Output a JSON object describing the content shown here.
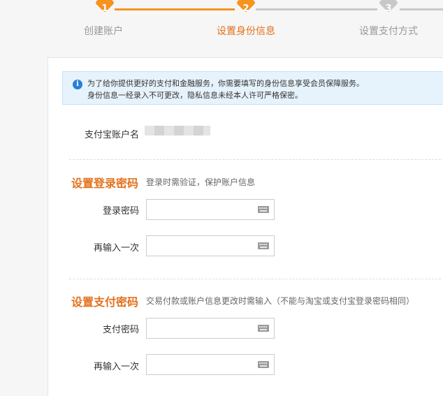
{
  "stepper": {
    "steps": [
      {
        "number": "1",
        "label": "创建账户"
      },
      {
        "number": "2",
        "label": "设置身份信息"
      },
      {
        "number": "3",
        "label": "设置支付方式"
      }
    ],
    "active_step": 2
  },
  "notice": {
    "icon": "info-icon",
    "line1": "为了给你提供更好的支付和金融服务，你需要填写的身份信息享受会员保障服务。",
    "line2": "身份信息一经录入不可更改，隐私信息未经本人许可严格保密。"
  },
  "account": {
    "label": "支付宝账户名",
    "value_masked": true
  },
  "login_password": {
    "title": "设置登录密码",
    "hint": "登录时需验证，保护账户信息",
    "fields": [
      {
        "label": "登录密码",
        "value": "",
        "icon": "keyboard-icon"
      },
      {
        "label": "再输入一次",
        "value": "",
        "icon": "keyboard-icon"
      }
    ]
  },
  "pay_password": {
    "title": "设置支付密码",
    "hint": "交易付款或账户信息更改时需输入（不能与淘宝或支付宝登录密码相同）",
    "fields": [
      {
        "label": "支付密码",
        "value": "",
        "icon": "keyboard-icon"
      },
      {
        "label": "再输入一次",
        "value": "",
        "icon": "keyboard-icon"
      }
    ]
  },
  "colors": {
    "accent": "#e2711d",
    "step_active": "#f7931e",
    "step_inactive": "#c8c8c8",
    "notice_bg": "#e7f3fc",
    "info_icon": "#2a7fd4"
  }
}
